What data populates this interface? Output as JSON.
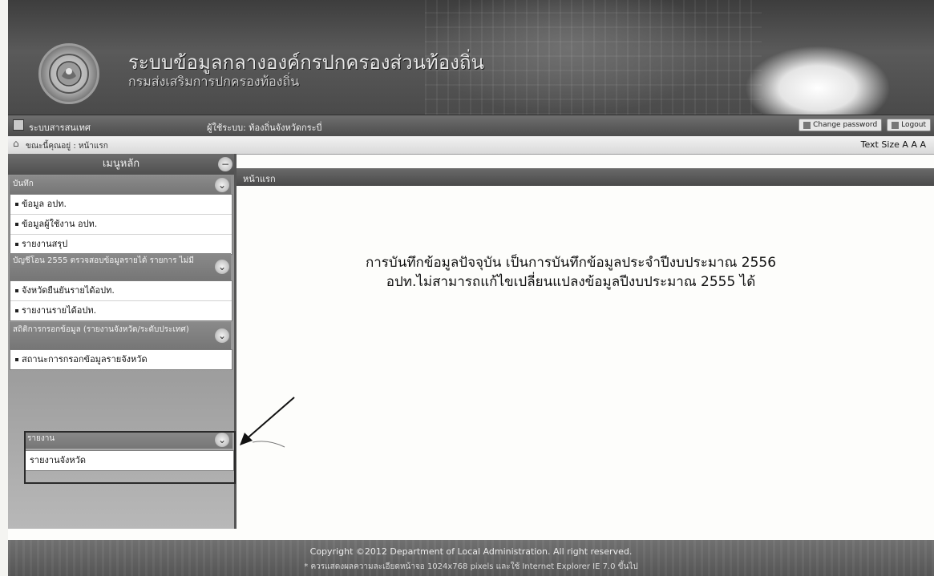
{
  "header": {
    "title": "ระบบข้อมูลกลางองค์กรปกครองส่วนท้องถิ่น",
    "subtitle": "กรมส่งเสริมการปกครองท้องถิ่น"
  },
  "navbar": {
    "system_label": "ระบบสารสนเทศ",
    "user_label": "ผู้ใช้ระบบ: ท้องถิ่นจังหวัดกระบี่",
    "change_password": "Change password",
    "logout": "Logout"
  },
  "breadcrumb": {
    "text": "ขณะนี้คุณอยู่ : หน้าแรก",
    "text_size_label": "Text Size",
    "text_size_options": "A A A"
  },
  "sidebar": {
    "title": "เมนูหลัก",
    "sections": [
      {
        "label": "บันทึก",
        "items": [
          "ข้อมูล อปท.",
          "ข้อมูลผู้ใช้งาน อปท.",
          "รายงานสรุป"
        ]
      },
      {
        "label": "บัญชีโอน 2555 ตรวจสอบข้อมูลรายได้ รายการ ไม่มี",
        "items": [
          "จังหวัดยืนยันรายได้อปท.",
          "รายงานรายได้อปท."
        ]
      },
      {
        "label": "สถิติการกรอกข้อมูล (รายงานจังหวัด/ระดับประเทศ)",
        "items": [
          "สถานะการกรอกข้อมูลรายจังหวัด"
        ]
      },
      {
        "label": "รายงาน",
        "items": [
          "รายงานจังหวัด"
        ]
      }
    ]
  },
  "content": {
    "header": "หน้าแรก",
    "notice_line1": "การบันทึกข้อมูลปัจจุบัน เป็นการบันทึกข้อมูลประจำปีงบประมาณ 2556",
    "notice_line2": "อปท.ไม่สามารถแก้ไขเปลี่ยนแปลงข้อมูลปีงบประมาณ 2555 ได้"
  },
  "footer": {
    "copyright": "Copyright ©2012 Department of Local Administration. All right reserved.",
    "note": "* ควรแสดงผลความละเอียดหน้าจอ 1024x768 pixels และใช้ Internet Explorer IE 7.0 ขึ้นไป"
  }
}
